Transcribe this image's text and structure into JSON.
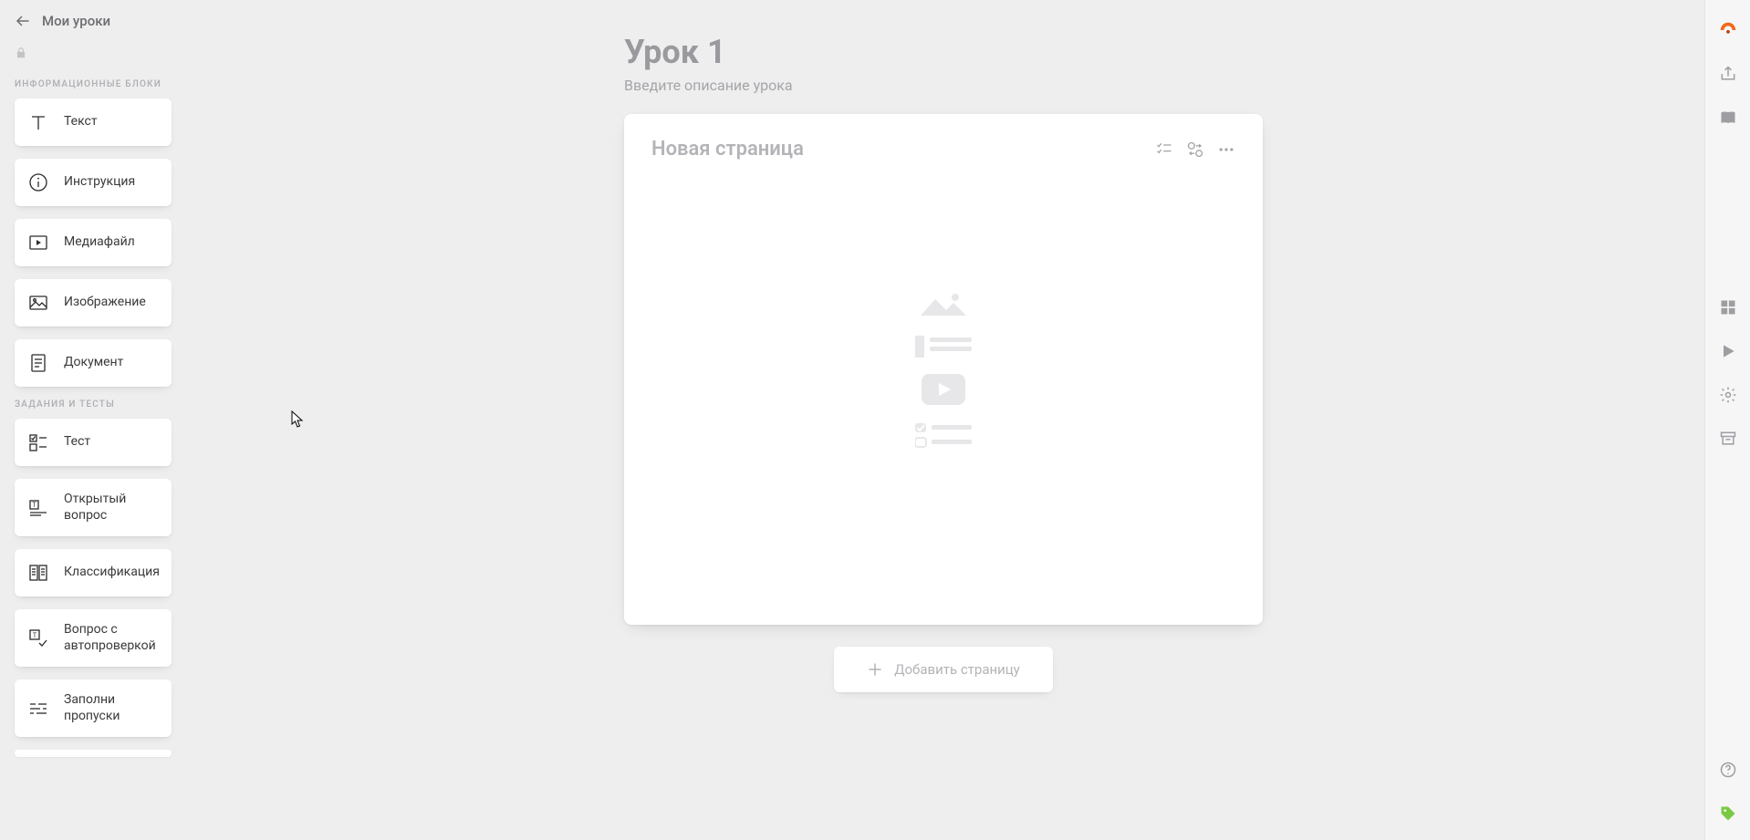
{
  "header": {
    "back_label": "Мои уроки"
  },
  "sidebar": {
    "section_info_label": "ИНФОРМАЦИОННЫЕ БЛОКИ",
    "section_tasks_label": "ЗАДАНИЯ И ТЕСТЫ",
    "info_blocks": [
      {
        "id": "text",
        "label": "Текст",
        "icon": "text-icon"
      },
      {
        "id": "instruction",
        "label": "Инструкция",
        "icon": "info-icon"
      },
      {
        "id": "media",
        "label": "Медиафайл",
        "icon": "play-box-icon"
      },
      {
        "id": "image",
        "label": "Изображение",
        "icon": "image-icon"
      },
      {
        "id": "document",
        "label": "Документ",
        "icon": "document-icon"
      }
    ],
    "task_blocks": [
      {
        "id": "quiz",
        "label": "Тест",
        "icon": "checklist-icon"
      },
      {
        "id": "open_q",
        "label": "Открытый вопрос",
        "icon": "open-question-icon"
      },
      {
        "id": "classify",
        "label": "Классификация",
        "icon": "columns-icon"
      },
      {
        "id": "auto_q",
        "label": "Вопрос с автопроверкой",
        "icon": "auto-check-icon"
      },
      {
        "id": "fill_blank",
        "label": "Заполни пропуски",
        "icon": "fill-blank-icon"
      }
    ]
  },
  "lesson": {
    "title": "Урок 1",
    "description_placeholder": "Введите описание урока"
  },
  "page": {
    "title_placeholder": "Новая страница"
  },
  "add_page_label": "Добавить страницу",
  "colors": {
    "brand": "#f06a18",
    "accent_green": "#7ac943",
    "muted": "#9a9a9e"
  }
}
